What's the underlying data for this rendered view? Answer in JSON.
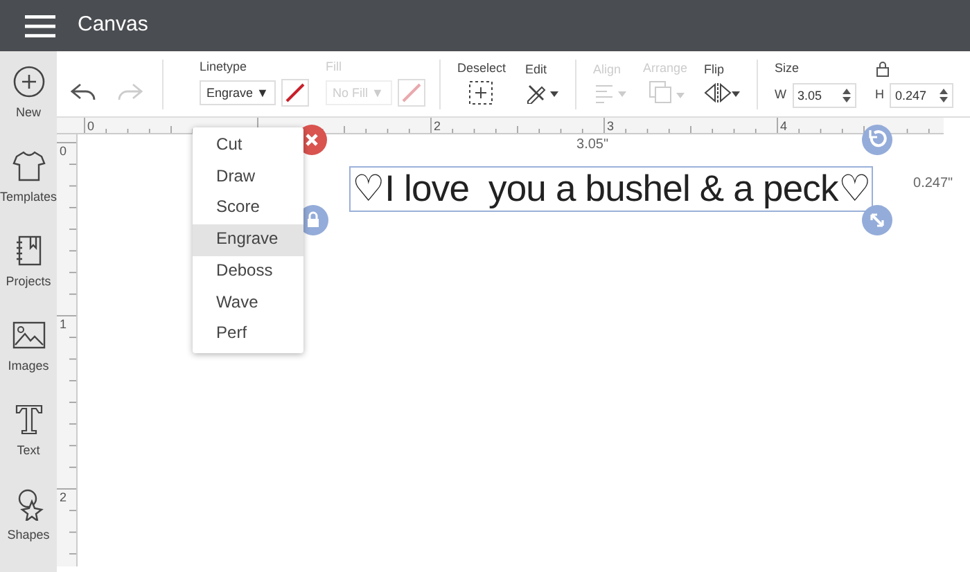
{
  "header": {
    "title": "Canvas"
  },
  "sidebar": {
    "items": [
      {
        "label": "New",
        "kind": "new"
      },
      {
        "label": "Templates",
        "kind": "templates"
      },
      {
        "label": "Projects",
        "kind": "projects"
      },
      {
        "label": "Images",
        "kind": "images"
      },
      {
        "label": "Text",
        "kind": "text"
      },
      {
        "label": "Shapes",
        "kind": "shapes"
      }
    ]
  },
  "toolbar": {
    "linetype": {
      "label": "Linetype",
      "value": "Engrave ▼"
    },
    "fill": {
      "label": "Fill",
      "value": "No Fill ▼",
      "disabled": true
    },
    "deselect": {
      "label": "Deselect"
    },
    "edit": {
      "label": "Edit"
    },
    "align": {
      "label": "Align",
      "disabled": true
    },
    "arrange": {
      "label": "Arrange",
      "disabled": true
    },
    "flip": {
      "label": "Flip",
      "disabled": false
    },
    "size": {
      "label": "Size",
      "w_label": "W",
      "w_value": "3.05",
      "h_label": "H",
      "h_value": "0.247"
    }
  },
  "linetype_menu": {
    "options": [
      {
        "label": "Cut",
        "selected": false
      },
      {
        "label": "Draw",
        "selected": false
      },
      {
        "label": "Score",
        "selected": false
      },
      {
        "label": "Engrave",
        "selected": true
      },
      {
        "label": "Deboss",
        "selected": false
      },
      {
        "label": "Wave",
        "selected": false
      },
      {
        "label": "Perf",
        "selected": false
      }
    ]
  },
  "rulers": {
    "x_labels": [
      "0",
      "2",
      "3",
      "4"
    ],
    "y_labels": [
      "0",
      "1",
      "2"
    ]
  },
  "selection": {
    "text": "♡I love  you a bushel & a peck♡",
    "width_label": "3.05\"",
    "height_label": "0.247\""
  }
}
